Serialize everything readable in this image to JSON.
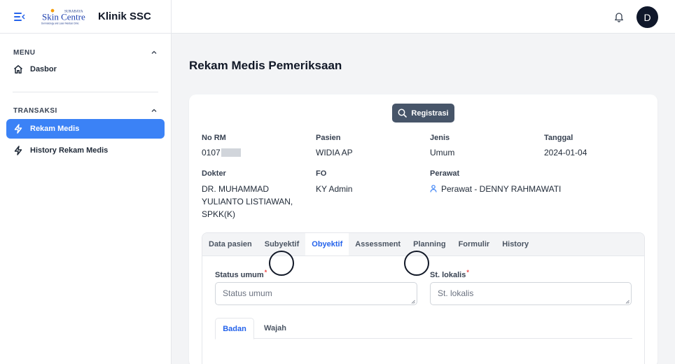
{
  "app": {
    "title": "Klinik SSC",
    "logo_text": "Skin Centre",
    "logo_top": "SURABAYA",
    "logo_sub": "Dermatology and Laser Medical Clinic"
  },
  "topbar": {
    "avatar_initial": "D"
  },
  "sidebar": {
    "sections": [
      {
        "title": "MENU",
        "items": [
          {
            "label": "Dasbor",
            "icon": "home-icon"
          }
        ]
      },
      {
        "title": "TRANSAKSI",
        "items": [
          {
            "label": "Rekam Medis",
            "icon": "bolt-icon",
            "active": true
          },
          {
            "label": "History Rekam Medis",
            "icon": "bolt-icon"
          }
        ]
      }
    ]
  },
  "page": {
    "title": "Rekam Medis Pemeriksaan",
    "registrasi_label": "Registrasi"
  },
  "record": {
    "no_rm_label": "No RM",
    "no_rm_value": "0107",
    "pasien_label": "Pasien",
    "pasien_value": "WIDIA AP",
    "jenis_label": "Jenis",
    "jenis_value": "Umum",
    "tanggal_label": "Tanggal",
    "tanggal_value": "2024-01-04",
    "dokter_label": "Dokter",
    "dokter_value_1": "DR. MUHAMMAD",
    "dokter_value_2": "YULIANTO LISTIAWAN,",
    "dokter_value_3": "SPKK(K)",
    "fo_label": "FO",
    "fo_value": "KY Admin",
    "perawat_label": "Perawat",
    "perawat_value": "Perawat - DENNY RAHMAWATI"
  },
  "tabs": [
    "Data pasien",
    "Subyektif",
    "Obyektif",
    "Assessment",
    "Planning",
    "Formulir",
    "History"
  ],
  "active_tab": "Obyektif",
  "form": {
    "status_umum_label": "Status umum",
    "status_umum_placeholder": "Status umum",
    "st_lokalis_label": "St. lokalis",
    "st_lokalis_placeholder": "St. lokalis",
    "required_mark": "*"
  },
  "subtabs": {
    "active": "Badan",
    "inactive": "Wajah"
  },
  "colors": {
    "accent": "#3b82f6",
    "link": "#2563eb",
    "button": "#475569",
    "avatar": "#0f172a"
  }
}
